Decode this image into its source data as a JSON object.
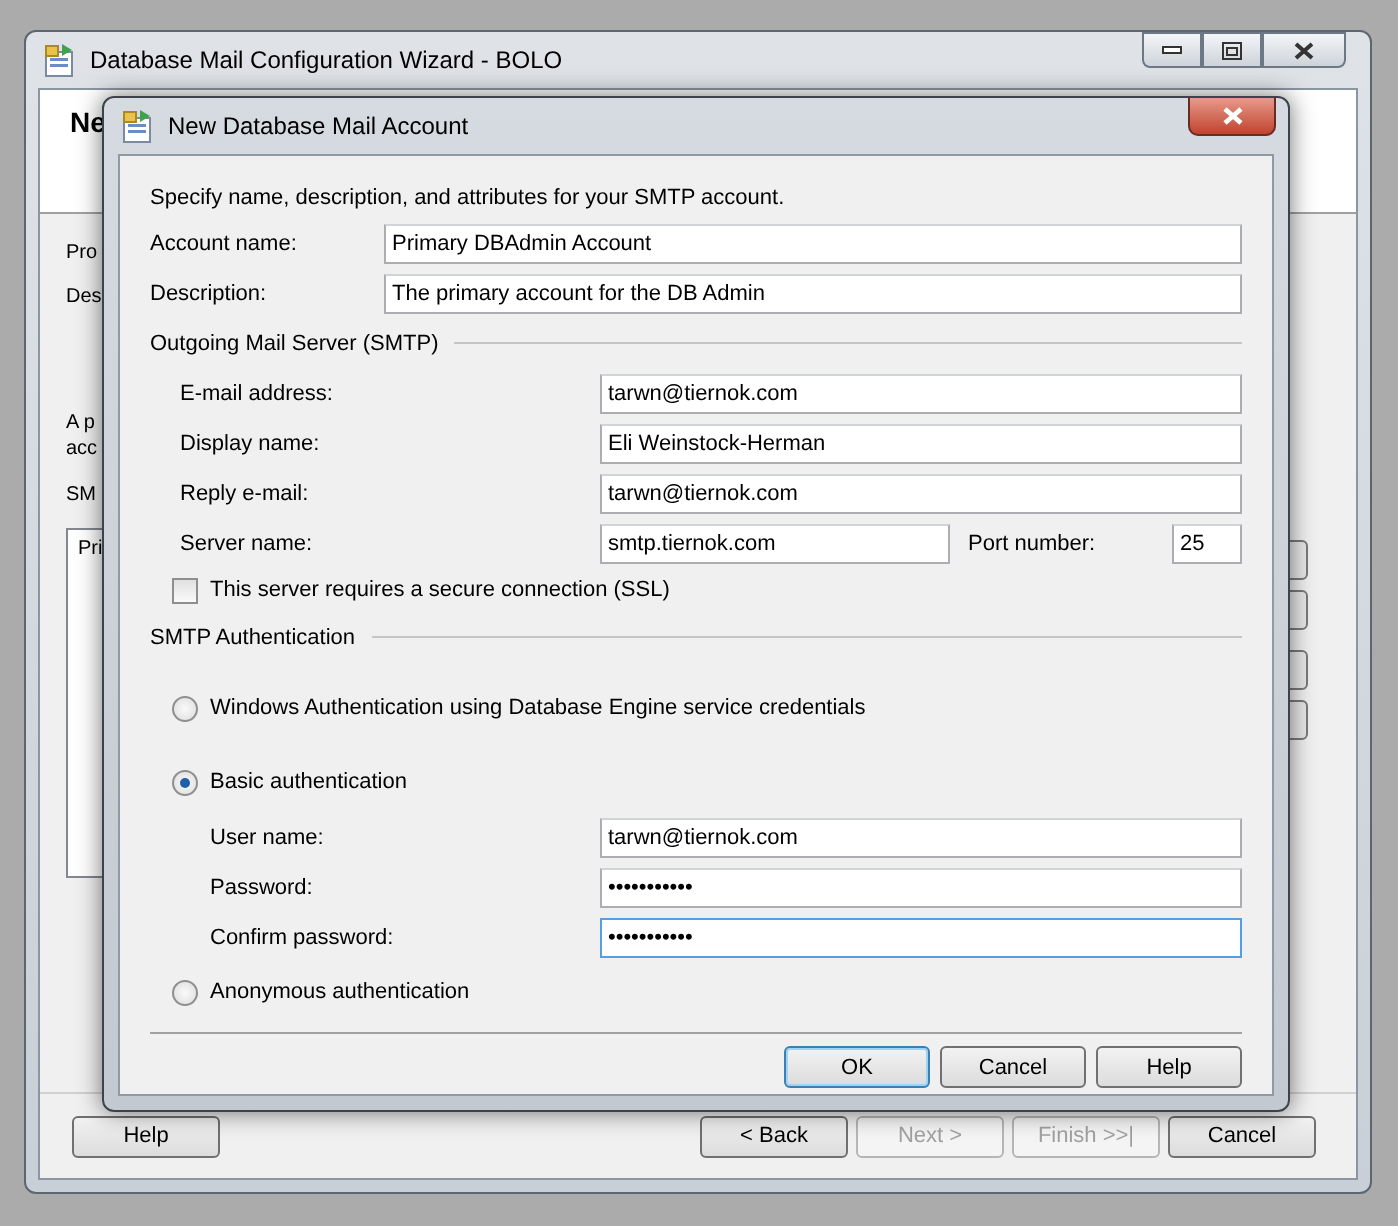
{
  "window": {
    "title": "Database Mail Configuration Wizard - BOLO",
    "heading": "Ne",
    "labels": [
      "Pro",
      "Des"
    ],
    "note": [
      "A p",
      "acc"
    ],
    "list_label": "SM",
    "list_column": "Pri",
    "buttons": [
      {
        "label": "Help",
        "disabled": false
      },
      {
        "label": "< Back",
        "disabled": false
      },
      {
        "label": "Next >",
        "disabled": true
      },
      {
        "label": "Finish >>|",
        "disabled": true
      },
      {
        "label": "Cancel",
        "disabled": false
      }
    ]
  },
  "dialog": {
    "title": "New Database Mail Account",
    "intro": "Specify name, description, and attributes for your SMTP account.",
    "account_fields": [
      {
        "label": "Account name:",
        "value": "Primary DBAdmin Account"
      },
      {
        "label": "Description:",
        "value": "The primary account for the DB Admin"
      }
    ],
    "outgoing": {
      "title": "Outgoing Mail Server (SMTP)",
      "fields": [
        {
          "label": "E-mail address:",
          "value": "tarwn@tiernok.com"
        },
        {
          "label": "Display name:",
          "value": "Eli Weinstock-Herman"
        },
        {
          "label": "Reply e-mail:",
          "value": "tarwn@tiernok.com"
        }
      ],
      "server_name": {
        "label": "Server name:",
        "value": "smtp.tiernok.com"
      },
      "port": {
        "label": "Port number:",
        "value": "25"
      },
      "ssl": {
        "label": "This server requires a secure connection (SSL)",
        "checked": false
      }
    },
    "auth": {
      "title": "SMTP Authentication",
      "options": [
        {
          "label": "Windows Authentication using Database Engine service credentials",
          "selected": false
        },
        {
          "label": "Basic authentication",
          "selected": true,
          "fields": [
            {
              "label": "User name:",
              "value": "tarwn@tiernok.com",
              "focused": false
            },
            {
              "label": "Password:",
              "value": "•••••••••••",
              "focused": false
            },
            {
              "label": "Confirm password:",
              "value": "•••••••••••",
              "focused": true
            }
          ]
        },
        {
          "label": "Anonymous authentication",
          "selected": false
        }
      ]
    },
    "buttons": [
      {
        "label": "OK",
        "default": true
      },
      {
        "label": "Cancel",
        "default": false
      },
      {
        "label": "Help",
        "default": false
      }
    ]
  }
}
